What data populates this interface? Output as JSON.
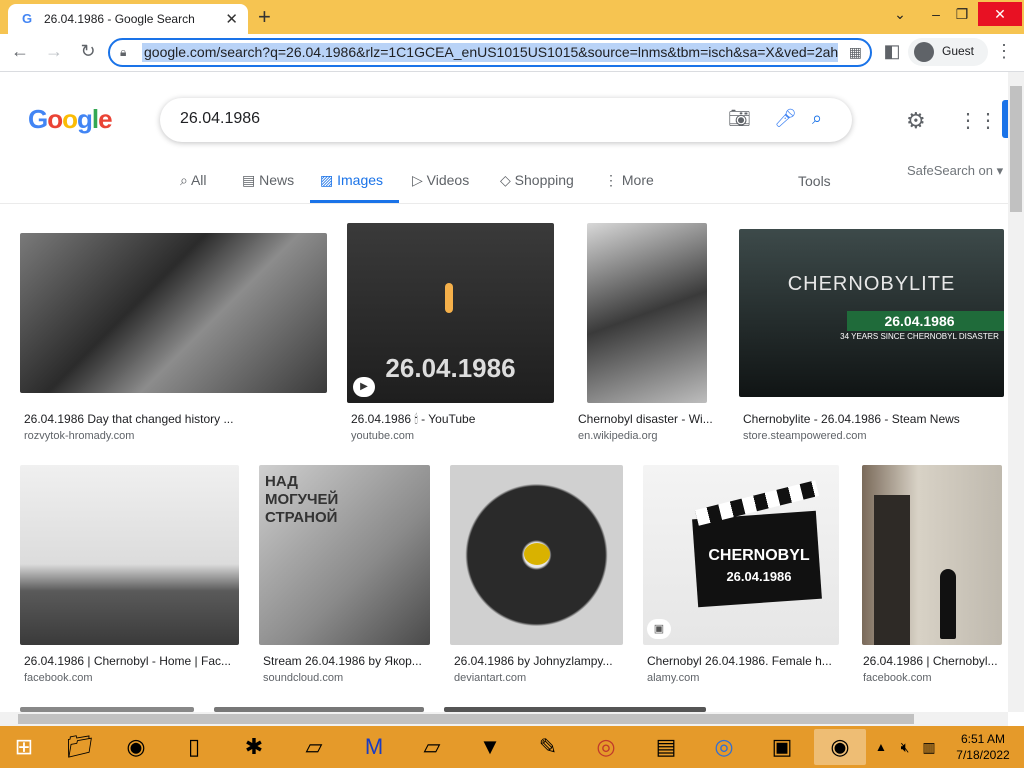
{
  "browser": {
    "tab_title": "26.04.1986 - Google Search",
    "url": "google.com/search?q=26.04.1986&rlz=1C1GCEA_enUS1015US1015&source=lnms&tbm=isch&sa=X&ved=2ahU",
    "profile_label": "Guest"
  },
  "google": {
    "query": "26.04.1986",
    "tabs": [
      "All",
      "News",
      "Images",
      "Videos",
      "Shopping",
      "More"
    ],
    "tools_label": "Tools",
    "safesearch_label": "SafeSearch on"
  },
  "results": [
    {
      "caption": "26.04.1986 Day that changed history ...",
      "source": "rozvytok-hromady.com"
    },
    {
      "caption": "26.04.1986 🕯 - YouTube",
      "source": "youtube.com",
      "thumb_text": "26.04.1986"
    },
    {
      "caption": "Chernobyl disaster - Wi...",
      "source": "en.wikipedia.org"
    },
    {
      "caption": "Chernobylite - 26.04.1986 - Steam News",
      "source": "store.steampowered.com",
      "thumb_title": "CHERNOBYLITE",
      "thumb_text": "26.04.1986",
      "thumb_sub": "34 YEARS SINCE CHERNOBYL DISASTER"
    },
    {
      "caption": "26.04.1986 | Chernobyl - Home | Fac...",
      "source": "facebook.com"
    },
    {
      "caption": "Stream 26.04.1986 by Якор...",
      "source": "soundcloud.com",
      "thumb_text": "НАД МОГУЧЕЙ СТРАНОЙ"
    },
    {
      "caption": "26.04.1986 by Johnyzlampy...",
      "source": "deviantart.com"
    },
    {
      "caption": "Chernobyl 26.04.1986. Female h...",
      "source": "alamy.com",
      "thumb_title": "CHERNOBYL",
      "thumb_text": "26.04.1986"
    },
    {
      "caption": "26.04.1986 | Chernobyl...",
      "source": "facebook.com"
    }
  ],
  "taskbar": {
    "time": "6:51 AM",
    "date": "7/18/2022"
  },
  "colors": {
    "titlebar": "#f6c451",
    "taskbar": "#e59a2a",
    "accent": "#1a73e8"
  }
}
